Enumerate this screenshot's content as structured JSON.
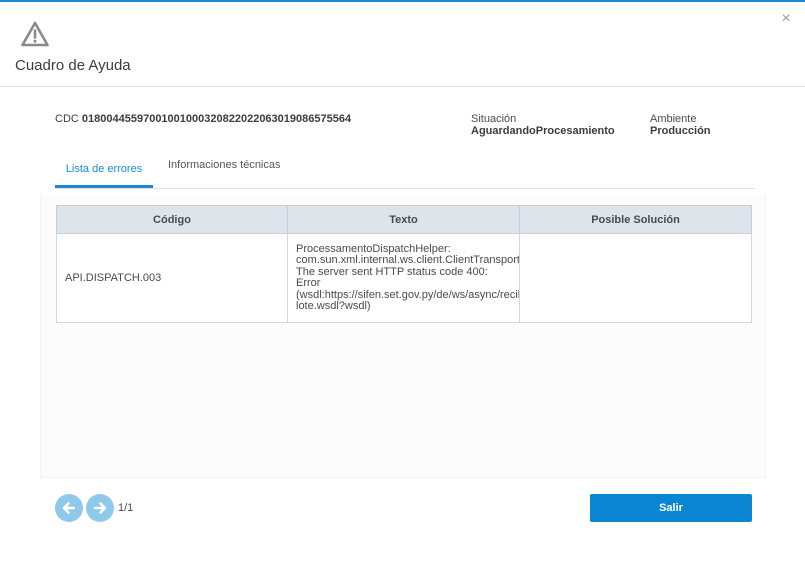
{
  "dialog": {
    "title": "Cuadro de Ayuda",
    "close_glyph": "×",
    "icon": "warning-triangle-icon"
  },
  "doc": {
    "cdc_label": "CDC",
    "cdc_value": "01800445597001001000320822022063019086575564",
    "situacion_label": "Situación",
    "situacion_value": "AguardandoProcesamiento",
    "ambiente_label": "Ambiente",
    "ambiente_value": "Producción"
  },
  "tabs": [
    {
      "label": "Lista de errores",
      "active": true
    },
    {
      "label": "Informaciones técnicas",
      "active": false
    }
  ],
  "table": {
    "headers": [
      "Código",
      "Texto",
      "Posible Solución"
    ],
    "rows": [
      {
        "codigo": "API.DISPATCH.003",
        "texto": "ProcessamentoDispatchHelper:\ncom.sun.xml.internal.ws.client.ClientTransportException:\nThe server sent HTTP status code 400:\nError\n(wsdl:https://sifen.set.gov.py/de/ws/async/recibe-\nlote.wsdl?wsdl)",
        "solucion": ""
      }
    ]
  },
  "pager": {
    "count": "1/1",
    "prev_icon": "arrow-left-icon",
    "next_icon": "arrow-right-icon"
  },
  "actions": {
    "salir_label": "Salir"
  },
  "colors": {
    "accent": "#1a8ad4",
    "button": "#0a85d1",
    "pager_button": "#8ec9ec",
    "table_header": "#dde4ea"
  }
}
